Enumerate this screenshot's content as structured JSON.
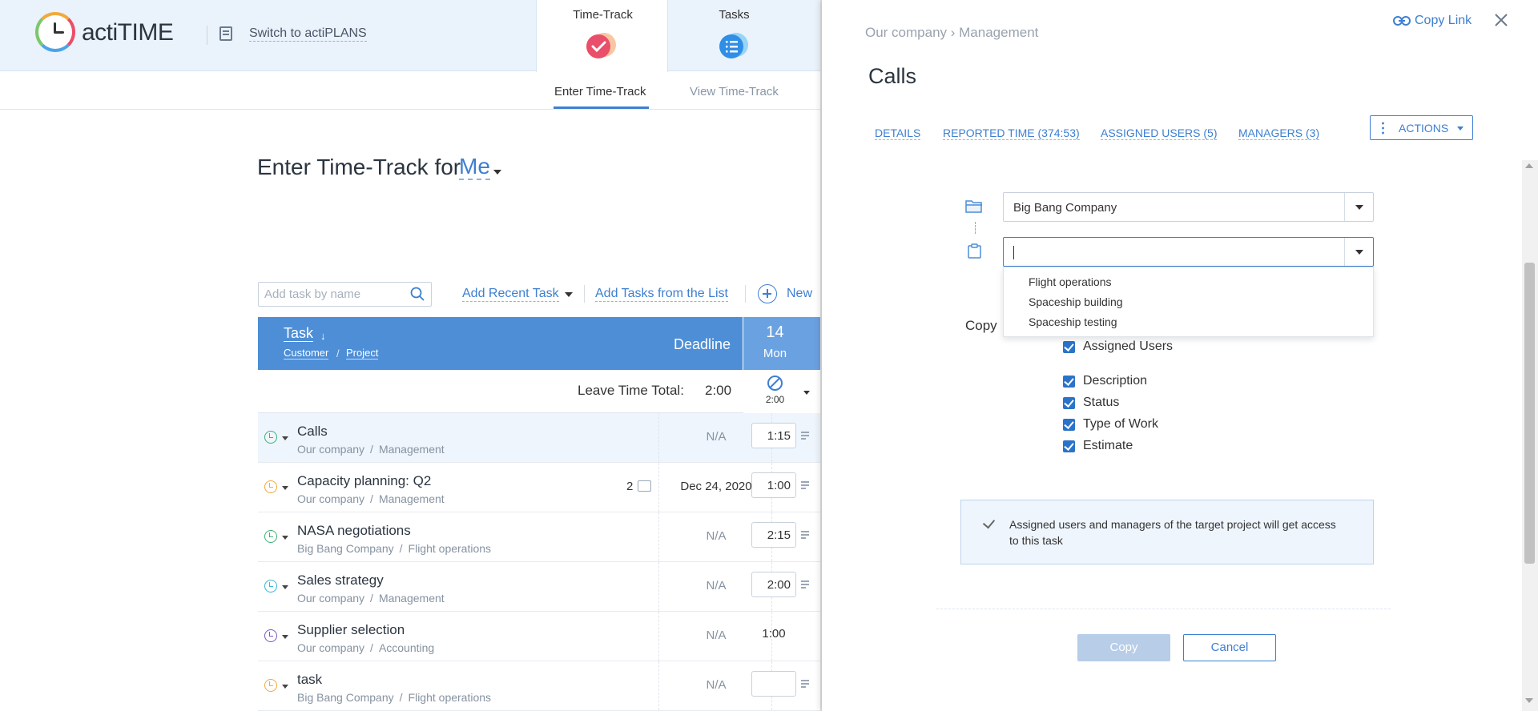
{
  "app": {
    "brand": "actiTIME",
    "switch_label": "Switch to actiPLANS",
    "tabs": [
      {
        "label": "Time-Track",
        "icon": "time-track-icon",
        "active": true
      },
      {
        "label": "Tasks",
        "icon": "tasks-icon",
        "active": false
      }
    ],
    "subnav": {
      "enter": "Enter Time-Track",
      "view": "View Time-Track"
    }
  },
  "main": {
    "title_prefix": "Enter Time-Track for",
    "user": "Me",
    "search_placeholder": "Add task by name",
    "add_recent": "Add Recent Task",
    "add_list": "Add Tasks from the List",
    "new": "New",
    "grid": {
      "task_header": "Task",
      "sort_arrow": "↓",
      "customer_header": "Customer",
      "slash": "/",
      "project_header": "Project",
      "deadline_header": "Deadline",
      "day_number": "14",
      "day_name": "Mon",
      "leave_label": "Leave Time Total:",
      "leave_total": "2:00",
      "leave_day_value": "2:00"
    },
    "rows": [
      {
        "name": "Calls",
        "customer": "Our company",
        "project": "Management",
        "deadline": "N/A",
        "time": "1:15",
        "status_color": "#3bb273",
        "selected": true,
        "comments": ""
      },
      {
        "name": "Capacity planning: Q2",
        "customer": "Our company",
        "project": "Management",
        "deadline": "Dec 24, 2020",
        "time": "1:00",
        "status_color": "#f2a93b",
        "selected": false,
        "comments": "2"
      },
      {
        "name": "NASA negotiations",
        "customer": "Big Bang Company",
        "project": "Flight operations",
        "deadline": "N/A",
        "time": "2:15",
        "status_color": "#3bb273",
        "selected": false,
        "comments": ""
      },
      {
        "name": "Sales strategy",
        "customer": "Our company",
        "project": "Management",
        "deadline": "N/A",
        "time": "2:00",
        "status_color": "#38b6d8",
        "selected": false,
        "comments": ""
      },
      {
        "name": "Supplier selection",
        "customer": "Our company",
        "project": "Accounting",
        "deadline": "N/A",
        "time": "1:00",
        "status_color": "#7e57c2",
        "selected": false,
        "comments": ""
      },
      {
        "name": "task",
        "customer": "Big Bang Company",
        "project": "Flight operations",
        "deadline": "N/A",
        "time": "",
        "status_color": "#f2a93b",
        "selected": false,
        "comments": ""
      }
    ]
  },
  "panel": {
    "breadcrumb": "Our company › Management",
    "copy_link": "Copy Link",
    "title": "Calls",
    "tabs": [
      "DETAILS",
      "REPORTED TIME (374:53)",
      "ASSIGNED USERS (5)",
      "MANAGERS (3)"
    ],
    "actions": "ACTIONS",
    "customer_value": "Big Bang Company",
    "project_value": "",
    "dropdown_options": [
      "Flight operations",
      "Spaceship building",
      "Spaceship testing"
    ],
    "copy_label": "Copy",
    "checkboxes": [
      "Assigned Users",
      "Description",
      "Status",
      "Type of Work",
      "Estimate"
    ],
    "info": "Assigned users and managers of the target project will get access to this task",
    "copy_button": "Copy",
    "cancel_button": "Cancel"
  },
  "colors": {
    "accent": "#3d7fd1",
    "grid_header": "#4d8ed6",
    "day_header": "#6aa1e0",
    "time_track_icon": "#e94e6b",
    "tasks_icon": "#2f8ee5"
  }
}
